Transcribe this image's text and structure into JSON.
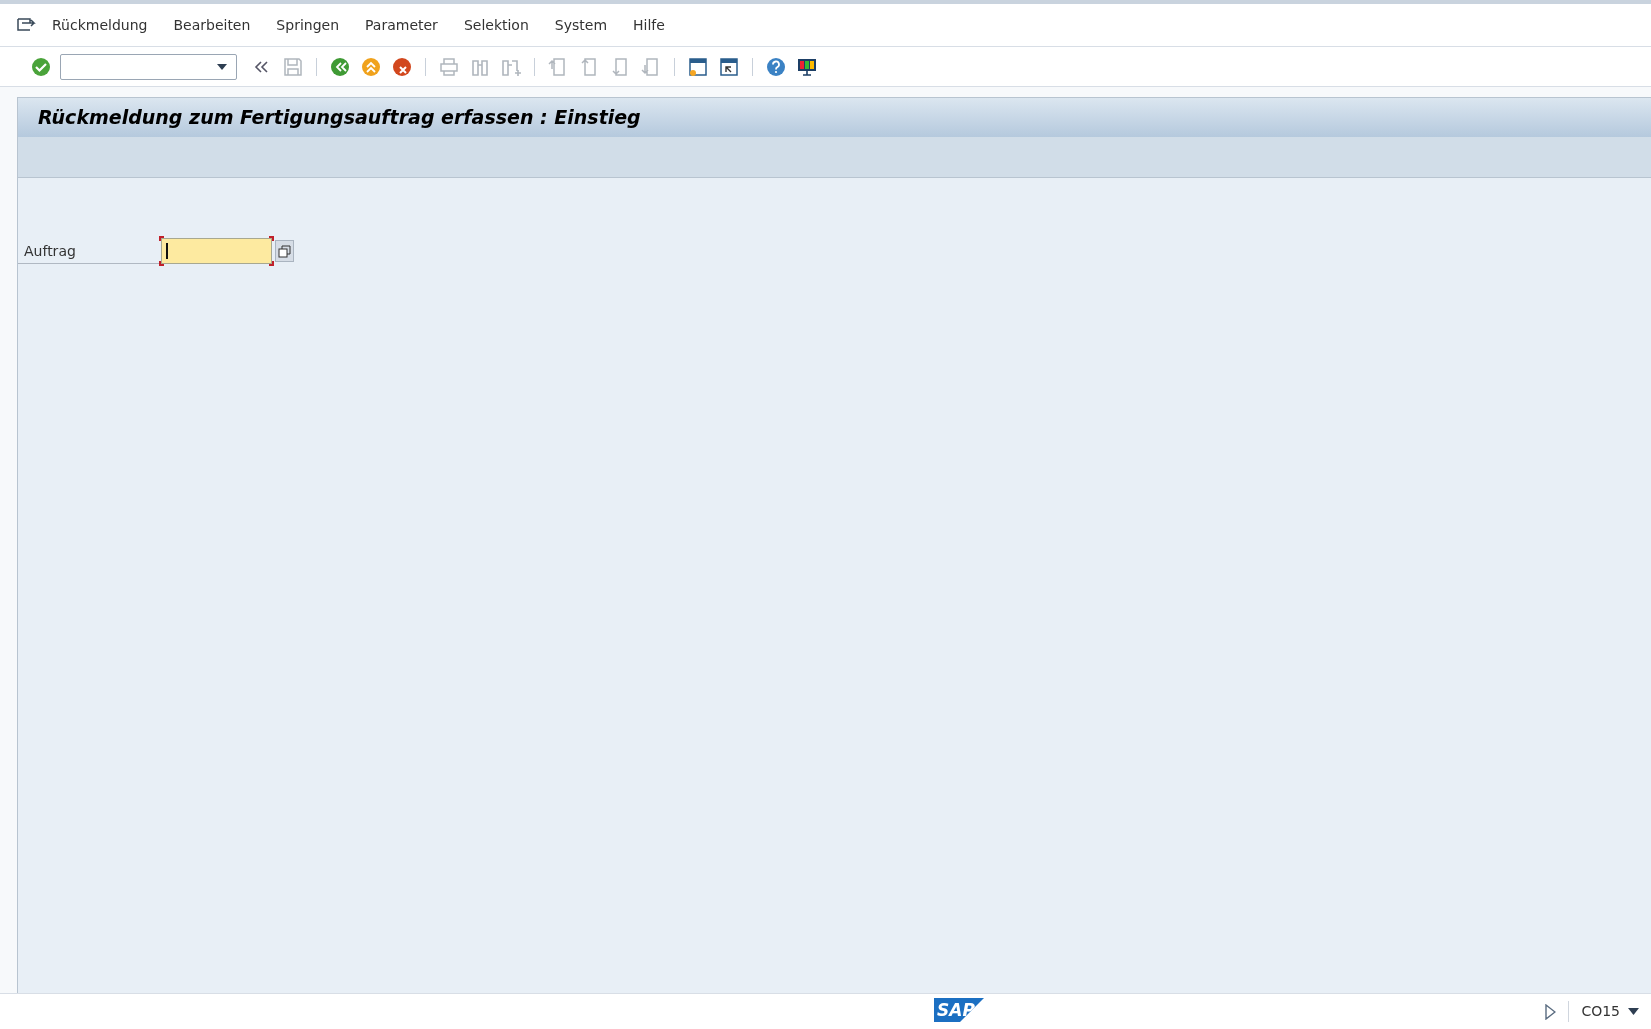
{
  "menu": [
    {
      "label": "Rückmeldung"
    },
    {
      "label": "Bearbeiten"
    },
    {
      "label": "Springen"
    },
    {
      "label": "Parameter"
    },
    {
      "label": "Selektion"
    },
    {
      "label": "System"
    },
    {
      "label": "Hilfe"
    }
  ],
  "toolbar": [
    {
      "kind": "enter",
      "disabled": false
    },
    {
      "kind": "command",
      "disabled": false
    },
    {
      "kind": "collapse",
      "disabled": false
    },
    {
      "kind": "save",
      "disabled": true
    },
    {
      "kind": "sep"
    },
    {
      "kind": "back",
      "disabled": false
    },
    {
      "kind": "exit",
      "disabled": false
    },
    {
      "kind": "cancel",
      "disabled": false
    },
    {
      "kind": "sep"
    },
    {
      "kind": "print",
      "disabled": true
    },
    {
      "kind": "find",
      "disabled": true
    },
    {
      "kind": "findnext",
      "disabled": true
    },
    {
      "kind": "sep"
    },
    {
      "kind": "first",
      "disabled": true
    },
    {
      "kind": "prev",
      "disabled": true
    },
    {
      "kind": "next",
      "disabled": true
    },
    {
      "kind": "last",
      "disabled": true
    },
    {
      "kind": "sep"
    },
    {
      "kind": "newsession",
      "disabled": false
    },
    {
      "kind": "shortcut",
      "disabled": false
    },
    {
      "kind": "sep"
    },
    {
      "kind": "help",
      "disabled": false
    },
    {
      "kind": "layout",
      "disabled": false
    }
  ],
  "screen_title": "Rückmeldung zum Fertigungsauftrag erfassen : Einstieg",
  "fields": [
    {
      "label": "Auftrag",
      "required": true,
      "focused": true
    }
  ],
  "status_bar": {
    "logo": "SAP",
    "transaction": "CO15"
  }
}
